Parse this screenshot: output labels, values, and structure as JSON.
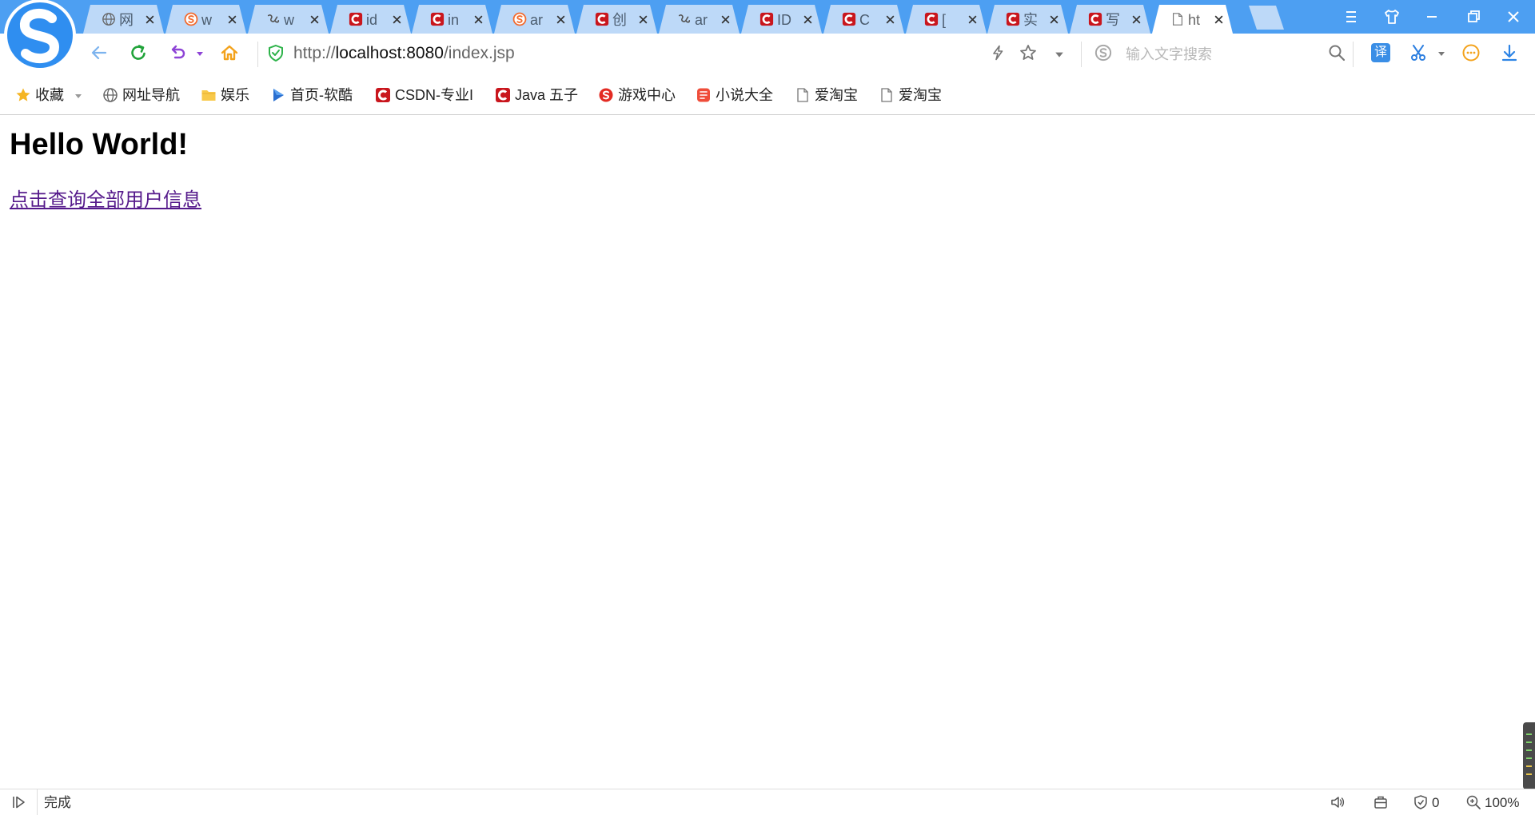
{
  "tabs": [
    {
      "title": "网",
      "icon": "globe-icon"
    },
    {
      "title": "w",
      "icon": "sogou-icon"
    },
    {
      "title": "w",
      "icon": "site-icon"
    },
    {
      "title": "id",
      "icon": "csdn-icon"
    },
    {
      "title": "in",
      "icon": "csdn-icon"
    },
    {
      "title": "ar",
      "icon": "sogou-icon"
    },
    {
      "title": "创",
      "icon": "csdn-icon"
    },
    {
      "title": "ar",
      "icon": "site-icon"
    },
    {
      "title": "ID",
      "icon": "csdn-icon"
    },
    {
      "title": "C",
      "icon": "csdn-icon"
    },
    {
      "title": "[",
      "icon": "csdn-icon"
    },
    {
      "title": "实",
      "icon": "csdn-icon"
    },
    {
      "title": "写",
      "icon": "csdn-icon"
    },
    {
      "title": "ht",
      "icon": "document-icon",
      "active": true
    }
  ],
  "window_controls": [
    "menu-icon",
    "skin-icon",
    "minimize-icon",
    "restore-icon",
    "close-icon"
  ],
  "address_bar": {
    "url_scheme": "http://",
    "url_host": "localhost:8080",
    "url_path": "/index.jsp",
    "security_icon": "verified-shield-icon"
  },
  "search": {
    "placeholder": "输入文字搜索",
    "engine_icon": "sogou-icon"
  },
  "toolbar": {
    "translate_glyph": "译"
  },
  "bookmarks": [
    {
      "label": "收藏",
      "icon": "star-icon"
    },
    {
      "label": "网址导航",
      "icon": "globe-icon"
    },
    {
      "label": "娱乐",
      "icon": "folder-icon"
    },
    {
      "label": "首页-软酷",
      "icon": "play-icon"
    },
    {
      "label": "CSDN-专业I",
      "icon": "csdn-icon"
    },
    {
      "label": "Java 五子",
      "icon": "csdn-icon"
    },
    {
      "label": "游戏中心",
      "icon": "game-icon"
    },
    {
      "label": "小说大全",
      "icon": "novel-icon"
    },
    {
      "label": "爱淘宝",
      "icon": "document-icon"
    },
    {
      "label": "爱淘宝",
      "icon": "document-icon"
    }
  ],
  "page": {
    "heading": "Hello World!",
    "link_text": "点击查询全部用户信息"
  },
  "status_bar": {
    "status_text": "完成",
    "blocked_count": "0",
    "zoom": "100%"
  },
  "colors": {
    "tab_strip": "#4d9ff2",
    "tab_inactive": "#bdd9f8",
    "tab_active": "#ffffff",
    "link_visited": "#551a8b",
    "csdn_red": "#c9161d",
    "secure_green": "#2eb34a"
  }
}
